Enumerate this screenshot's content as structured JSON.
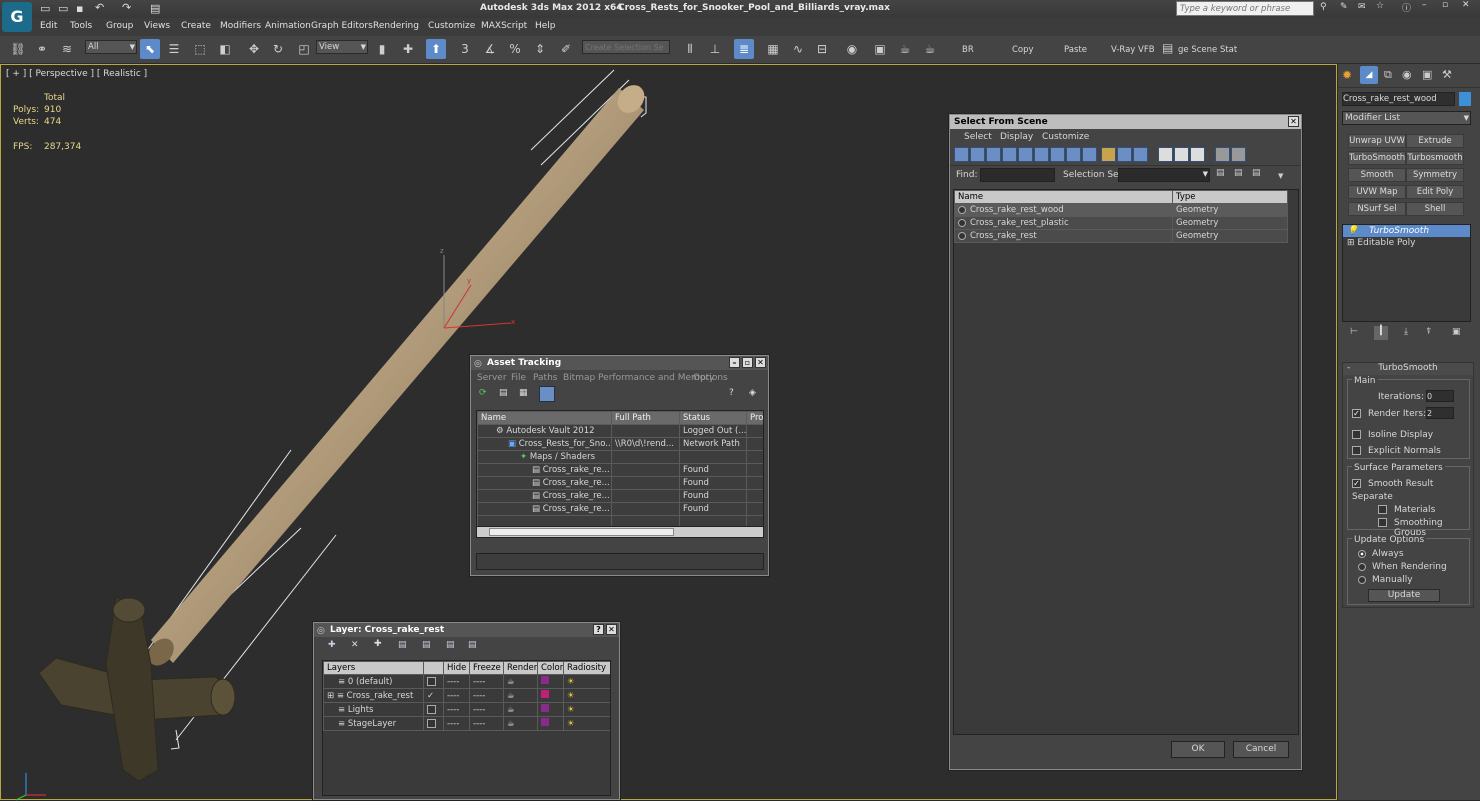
{
  "app": {
    "title": "Autodesk 3ds Max  2012 x64",
    "file": "Cross_Rests_for_Snooker_Pool_and_Billiards_vray.max",
    "search_placeholder": "Type a keyword or phrase"
  },
  "menu": [
    "Edit",
    "Tools",
    "Group",
    "Views",
    "Create",
    "Modifiers",
    "Animation",
    "Graph Editors",
    "Rendering",
    "Customize",
    "MAXScript",
    "Help"
  ],
  "toolbar": {
    "filter_value": "All",
    "refcoord_value": "View",
    "selection_set_placeholder": "Create Selection Se",
    "br_label": "BR",
    "copy_label": "Copy",
    "paste_label": "Paste",
    "vfb_label": "V-Ray VFB",
    "scene_state_label": "ge Scene Stat",
    "snap_label": "3"
  },
  "viewport": {
    "label": "[ + ] [ Perspective ] [ Realistic ]",
    "stats": {
      "total_label": "Total",
      "polys_label": "Polys:",
      "polys_value": "910",
      "verts_label": "Verts:",
      "verts_value": "474",
      "fps_label": "FPS:",
      "fps_value": "287,374"
    },
    "gizmo": {
      "x": "x",
      "y": "y",
      "z": "z"
    }
  },
  "select_from_scene": {
    "title": "Select From Scene",
    "menu": [
      "Select",
      "Display",
      "Customize"
    ],
    "find_label": "Find:",
    "selection_set_label": "Selection Set:",
    "columns": [
      "Name",
      "Type"
    ],
    "rows": [
      {
        "name": "Cross_rake_rest_wood",
        "type": "Geometry"
      },
      {
        "name": "Cross_rake_rest_plastic",
        "type": "Geometry"
      },
      {
        "name": "Cross_rake_rest",
        "type": "Geometry"
      }
    ],
    "ok_label": "OK",
    "cancel_label": "Cancel"
  },
  "asset_tracking": {
    "title": "Asset Tracking",
    "menu": [
      "Server",
      "File",
      "Paths",
      "Bitmap Performance and Memory",
      "Options"
    ],
    "columns": [
      "Name",
      "Full Path",
      "Status",
      "Pro"
    ],
    "rows": [
      {
        "name": "Autodesk Vault 2012",
        "path": "",
        "status": "Logged Out (..."
      },
      {
        "name": "Cross_Rests_for_Sno...",
        "path": "\\\\R0\\d\\!rend...",
        "status": "Network Path"
      },
      {
        "name": "Maps / Shaders",
        "path": "",
        "status": ""
      },
      {
        "name": "Cross_rake_re...",
        "path": "",
        "status": "Found"
      },
      {
        "name": "Cross_rake_re...",
        "path": "",
        "status": "Found"
      },
      {
        "name": "Cross_rake_re...",
        "path": "",
        "status": "Found"
      },
      {
        "name": "Cross_rake_re...",
        "path": "",
        "status": "Found"
      }
    ]
  },
  "layer": {
    "title": "Layer: Cross_rake_rest",
    "columns": [
      "Layers",
      "",
      "Hide",
      "Freeze",
      "Render",
      "Color",
      "Radiosity"
    ],
    "rows": [
      {
        "name": "0 (default)",
        "color": "#8a2a8a"
      },
      {
        "name": "Cross_rake_rest",
        "color": "#c0207a"
      },
      {
        "name": "Lights",
        "color": "#8a2a8a"
      },
      {
        "name": "StageLayer",
        "color": "#8a2a8a"
      }
    ],
    "dash": "----"
  },
  "command_panel": {
    "object_name": "Cross_rake_rest_wood",
    "object_color": "#3d8fd8",
    "modifier_list_label": "Modifier List",
    "modifier_buttons": [
      "Unwrap UVW",
      "Extrude",
      "TurboSmooth",
      "Turbosmooth",
      "Smooth",
      "Symmetry",
      "UVW Map",
      "Edit Poly",
      "NSurf Sel",
      "Shell"
    ],
    "stack": [
      "TurboSmooth",
      "Editable Poly"
    ],
    "rollout_title": "TurboSmooth",
    "main_label": "Main",
    "iterations_label": "Iterations:",
    "iterations_value": "0",
    "render_iters_label": "Render Iters:",
    "render_iters_value": "2",
    "isoline_label": "Isoline Display",
    "explicit_label": "Explicit Normals",
    "surface_label": "Surface Parameters",
    "smooth_result_label": "Smooth Result",
    "separate_label": "Separate",
    "materials_label": "Materials",
    "smoothing_groups_label": "Smoothing Groups",
    "update_options_label": "Update Options",
    "always_label": "Always",
    "when_rendering_label": "When Rendering",
    "manually_label": "Manually",
    "update_button": "Update"
  }
}
